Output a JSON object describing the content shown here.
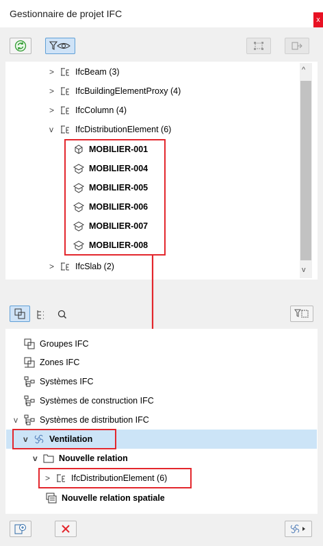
{
  "window": {
    "title": "Gestionnaire de projet IFC",
    "close_glyph": "x"
  },
  "top_tree": {
    "items": [
      {
        "label": "IfcBeam (3)",
        "chevron": ">",
        "bold": false
      },
      {
        "label": "IfcBuildingElementProxy (4)",
        "chevron": ">",
        "bold": false
      },
      {
        "label": "IfcColumn (4)",
        "chevron": ">",
        "bold": false
      },
      {
        "label": "IfcDistributionElement (6)",
        "chevron": "v",
        "bold": false
      }
    ],
    "children": [
      {
        "label": "MOBILIER-001"
      },
      {
        "label": "MOBILIER-004"
      },
      {
        "label": "MOBILIER-005"
      },
      {
        "label": "MOBILIER-006"
      },
      {
        "label": "MOBILIER-007"
      },
      {
        "label": "MOBILIER-008"
      }
    ],
    "last": {
      "label": "IfcSlab (2)",
      "chevron": ">"
    }
  },
  "bottom_tree": {
    "items": [
      {
        "label": "Groupes IFC"
      },
      {
        "label": "Zones IFC"
      },
      {
        "label": "Systèmes IFC"
      },
      {
        "label": "Systèmes de construction IFC"
      },
      {
        "label": "Systèmes de distribution IFC"
      }
    ],
    "ventilation": "Ventilation",
    "nouvelle_relation": "Nouvelle relation",
    "ifc_dist": "IfcDistributionElement (6)",
    "spatial": "Nouvelle relation spatiale"
  },
  "colors": {
    "highlight": "#cce4f7",
    "red": "#e3262c",
    "accent_green": "#2e9a2e"
  }
}
